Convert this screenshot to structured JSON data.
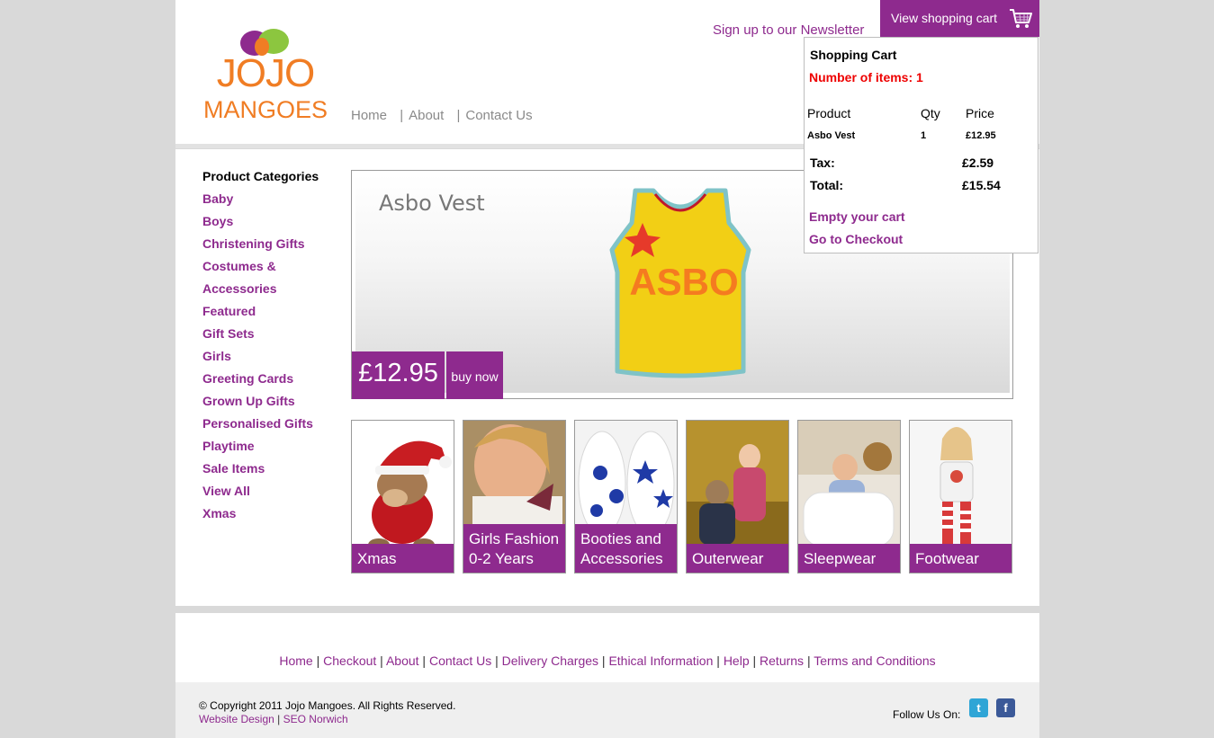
{
  "logo": {
    "line1": "JOJO",
    "line2": "MANGOES"
  },
  "topnav": {
    "items": [
      "Home",
      "About",
      "Contact Us"
    ],
    "separator": "|"
  },
  "header": {
    "newsletter": "Sign up to our Newsletter",
    "view_cart": "View shopping cart"
  },
  "categories": {
    "heading": "Product Categories",
    "items": [
      "Baby",
      "Boys",
      "Christening Gifts",
      "Costumes &",
      "Accessories",
      "Featured",
      "Gift Sets",
      "Girls",
      "Greeting Cards",
      "Grown Up Gifts",
      "Personalised Gifts",
      "Playtime",
      "Sale Items",
      "View All",
      "Xmas"
    ]
  },
  "hero": {
    "title": "Asbo Vest",
    "price": "£12.95",
    "buy": "buy now",
    "vest_text": "ASBO"
  },
  "tiles": [
    {
      "label": "Xmas"
    },
    {
      "label": "Girls Fashion 0-2 Years"
    },
    {
      "label": "Booties and Accessories"
    },
    {
      "label": "Outerwear"
    },
    {
      "label": "Sleepwear"
    },
    {
      "label": "Footwear"
    }
  ],
  "cart": {
    "title": "Shopping Cart",
    "num_items": "Number of items:  1",
    "headers": {
      "product": "Product",
      "qty": "Qty",
      "price": "Price"
    },
    "row": {
      "product": "Asbo Vest",
      "qty": "1",
      "price": "£12.95"
    },
    "tax_label": "Tax:",
    "tax_value": "£2.59",
    "total_label": "Total:",
    "total_value": "£15.54",
    "empty": "Empty your cart",
    "checkout": "Go to Checkout"
  },
  "footer": {
    "links": [
      "Home",
      "Checkout",
      "About",
      "Contact Us",
      "Delivery Charges",
      "Ethical Information",
      "Help",
      "Returns",
      "Terms and Conditions"
    ],
    "copyright": "© Copyright 2011 Jojo Mangoes. All Rights Reserved.",
    "credit1": "Website Design",
    "credit2": "SEO Norwich",
    "follow": "Follow Us On:",
    "twitter": "t",
    "facebook": "f"
  },
  "colors": {
    "brand_purple": "#8e2a8e",
    "brand_orange": "#f07d24",
    "brand_green": "#8cc63f",
    "alert_red": "#e00000"
  },
  "icons": [
    "shopping-cart-icon",
    "twitter-icon",
    "facebook-icon"
  ]
}
